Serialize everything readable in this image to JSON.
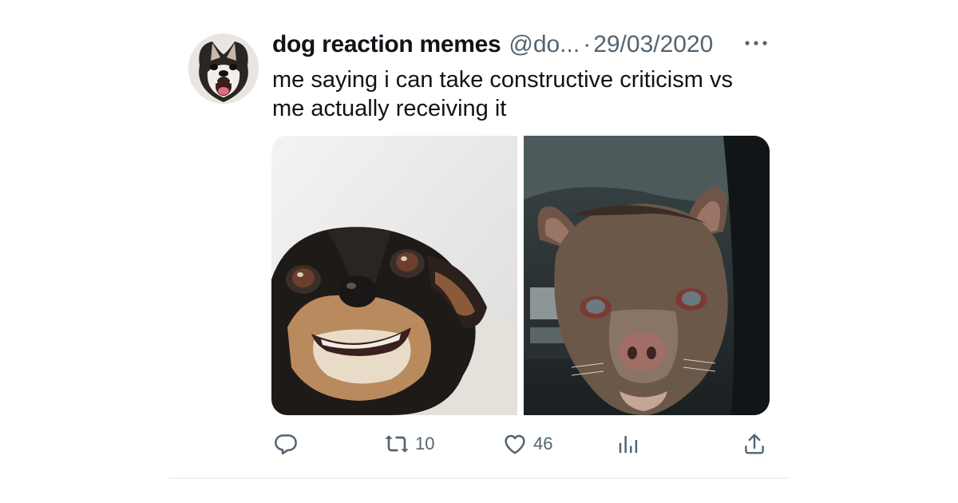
{
  "tweet": {
    "display_name": "dog reaction memes",
    "handle": "@do...",
    "separator": "·",
    "date": "29/03/2020",
    "text": "me saying i can take constructive criticism vs\nme actually receiving it"
  },
  "media": {
    "left_image": "smiling-chihuahua-photo",
    "right_image": "upset-dog-photo"
  },
  "actions": {
    "reply": {
      "icon": "reply-icon"
    },
    "retweet": {
      "icon": "retweet-icon",
      "count": "10"
    },
    "like": {
      "icon": "heart-icon",
      "count": "46"
    },
    "views": {
      "icon": "views-bar-chart-icon"
    },
    "share": {
      "icon": "share-icon"
    }
  },
  "colors": {
    "text_primary": "#0f1419",
    "text_secondary": "#536471",
    "icon": "#536471",
    "divider": "#eff3f4"
  }
}
